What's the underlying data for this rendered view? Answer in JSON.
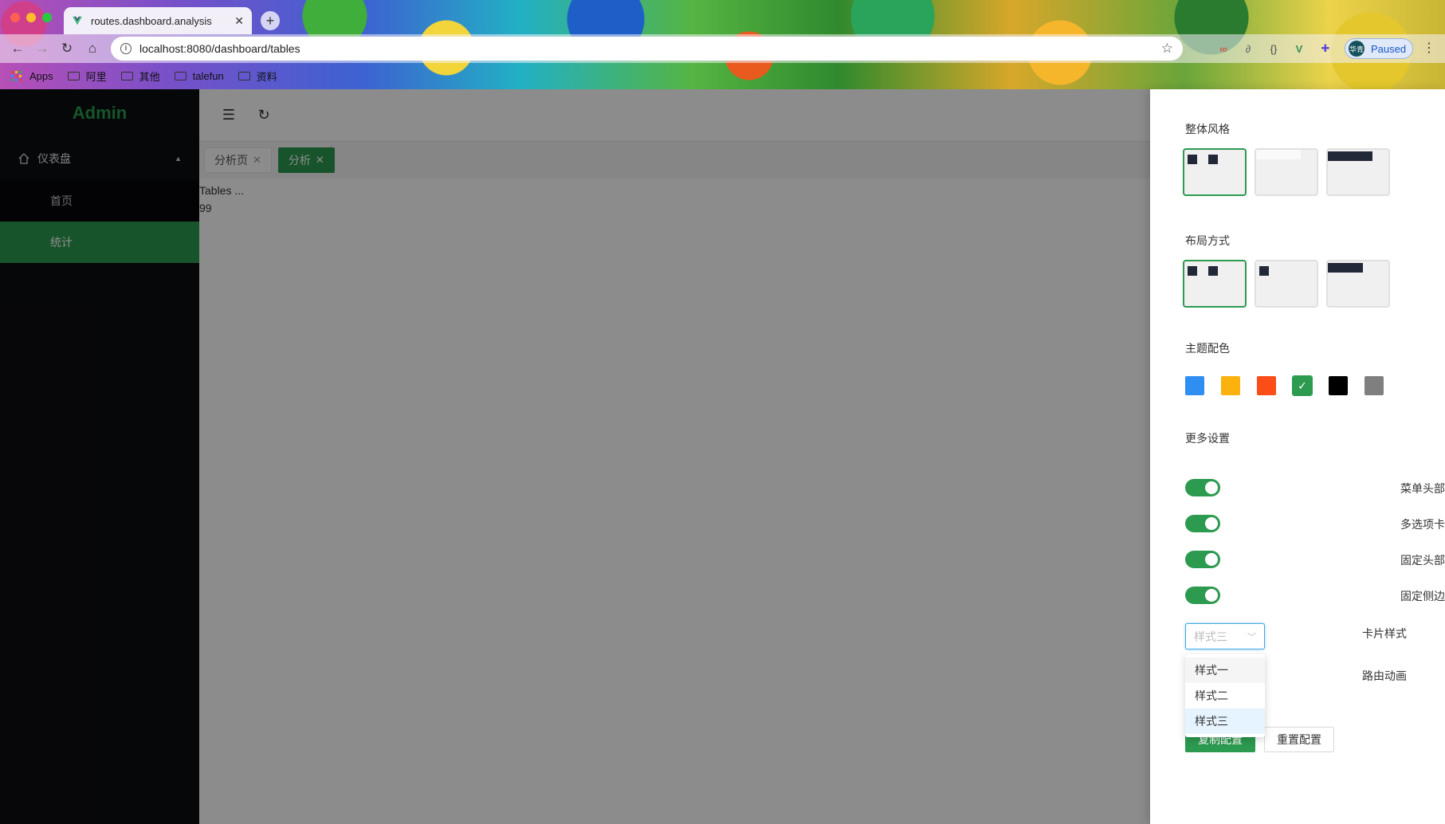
{
  "browser": {
    "tab_title": "routes.dashboard.analysis",
    "url": "localhost:8080/dashboard/tables",
    "profile_initials": "华青",
    "profile_status": "Paused",
    "bookmarks": [
      "Apps",
      "阿里",
      "其他",
      "talefun",
      "资料"
    ]
  },
  "sidebar": {
    "logo": "Admin",
    "menu": {
      "label": "仪表盘",
      "icon": "home-icon",
      "items": [
        {
          "label": "首页",
          "active": false
        },
        {
          "label": "统计",
          "active": true
        }
      ]
    }
  },
  "page_tabs": [
    {
      "label": "分析页",
      "active": false
    },
    {
      "label": "分析",
      "active": true
    }
  ],
  "content": {
    "line1": "Tables ...",
    "line2": "99"
  },
  "settings": {
    "overall_style_title": "整体风格",
    "layout_title": "布局方式",
    "theme_color_title": "主题配色",
    "theme_colors": [
      "#2f8ef1",
      "#fbb10e",
      "#fb4d17",
      "#2c9a4f",
      "#000000",
      "#7f7f7f"
    ],
    "selected_theme_index": 3,
    "more_title": "更多设置",
    "switches": [
      {
        "label": "菜单头部",
        "on": true
      },
      {
        "label": "多选项卡",
        "on": true
      },
      {
        "label": "固定头部",
        "on": true
      },
      {
        "label": "固定侧边",
        "on": true
      }
    ],
    "card_style": {
      "label": "卡片样式",
      "value": "样式三",
      "options": [
        "样式一",
        "样式二",
        "样式三"
      ]
    },
    "route_anim_label": "路由动画",
    "copy_button": "复制配置",
    "reset_button": "重置配置"
  },
  "colors": {
    "primary": "#2c9a4f",
    "sidebar_bg": "#0c0d11"
  }
}
